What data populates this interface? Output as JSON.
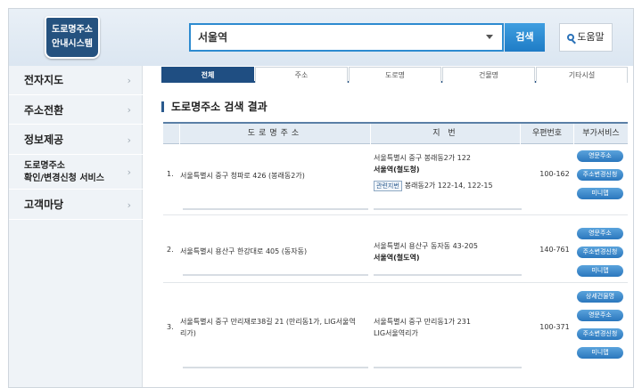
{
  "logo": {
    "line1": "도로명주소",
    "line2": "안내시스템"
  },
  "search": {
    "value": "서울역",
    "button": "검색",
    "help": "도움말"
  },
  "sidebar": {
    "items": [
      {
        "label": "전자지도"
      },
      {
        "label": "주소전환"
      },
      {
        "label": "정보제공"
      },
      {
        "label": "도로명주소",
        "label2": "확인/변경신청 서비스"
      },
      {
        "label": "고객마당"
      }
    ]
  },
  "tabs": [
    "전체",
    "주소",
    "도로명",
    "건물명",
    "기타시설"
  ],
  "section_title": "도로명주소 검색 결과",
  "table": {
    "headers": [
      "도로명주소",
      "지 번",
      "우편번호",
      "부가서비스"
    ],
    "rows": [
      {
        "num": "1.",
        "road": "서울특별시 중구 청파로 426 (봉래동2가)",
        "jibun1": "서울특별시 중구 봉래동2가 122",
        "jibun2": "서울역(철도청)",
        "related_label": "관련지번",
        "related": "봉래동2가 122-14, 122-15",
        "zip": "100-162",
        "services": [
          "영문주소",
          "주소변경신청",
          "미니맵"
        ]
      },
      {
        "num": "2.",
        "road": "서울특별시 용산구 한강대로 405 (동자동)",
        "jibun1": "서울특별시 용산구 동자동 43-205",
        "jibun2": "서울역(철도역)",
        "zip": "140-761",
        "services": [
          "영문주소",
          "주소변경신청",
          "미니맵"
        ]
      },
      {
        "num": "3.",
        "road": "서울특별시 중구 만리재로38길 21 (만리동1가, LIG서울역리가)",
        "jibun1": "서울특별시 중구 만리동1가 231",
        "jibun2": "LIG서울역리가",
        "zip": "100-371",
        "services": [
          "상세건물명",
          "영문주소",
          "주소변경신청",
          "미니맵"
        ]
      }
    ]
  }
}
